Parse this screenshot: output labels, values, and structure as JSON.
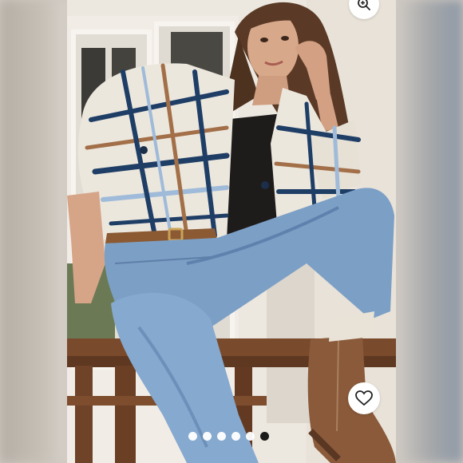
{
  "carousel": {
    "slide_count": 6,
    "active_index": 5,
    "image_alt": ""
  },
  "icons": {
    "zoom": "zoom-in-icon",
    "like": "heart-icon"
  },
  "colors": {
    "dot_inactive": "#ffffff",
    "dot_active": "#1a1a1a",
    "button_bg": "#ffffff",
    "icon": "#222222"
  }
}
